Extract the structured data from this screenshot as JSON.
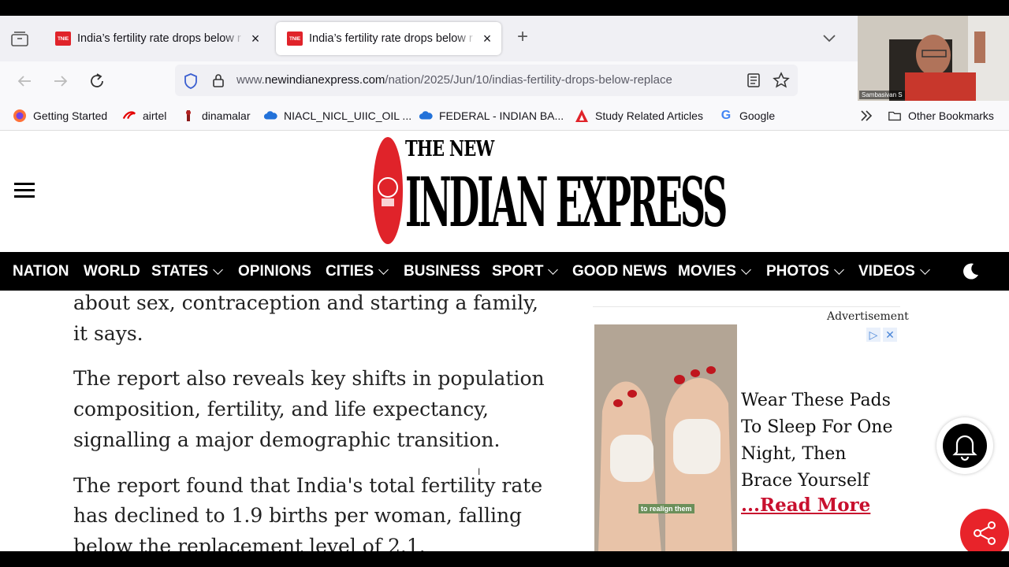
{
  "browser": {
    "tabs": [
      {
        "favicon_text": "TNIE",
        "title": "India’s fertility rate drops below r"
      },
      {
        "favicon_text": "TNIE",
        "title": "India’s fertility rate drops below r"
      }
    ],
    "url_prefix": "www.",
    "url_domain": "newindianexpress.com",
    "url_path": "/nation/2025/Jun/10/indias-fertility-drops-below-replace",
    "bookmarks": [
      "Getting Started",
      "airtel",
      "dinamalar",
      "NIACL_NICL_UIIC_OIL ...",
      "FEDERAL - INDIAN BA...",
      "Study Related Articles",
      "Google"
    ],
    "other_bookmarks": "Other Bookmarks",
    "video_name": "Sambasivan S"
  },
  "site": {
    "logo_top": "THE NEW",
    "logo_main": "INDIAN EXPRESS",
    "nav": [
      {
        "label": "NATION",
        "dropdown": false
      },
      {
        "label": "WORLD",
        "dropdown": false
      },
      {
        "label": "STATES",
        "dropdown": true
      },
      {
        "label": "OPINIONS",
        "dropdown": false
      },
      {
        "label": "CITIES",
        "dropdown": true
      },
      {
        "label": "BUSINESS",
        "dropdown": false
      },
      {
        "label": "SPORT",
        "dropdown": true
      },
      {
        "label": "GOOD NEWS",
        "dropdown": false
      },
      {
        "label": "MOVIES",
        "dropdown": true
      },
      {
        "label": "PHOTOS",
        "dropdown": true
      },
      {
        "label": "VIDEOS",
        "dropdown": true
      }
    ]
  },
  "article": {
    "paragraphs": [
      "about sex, contraception and starting a family, it says.",
      "The report also reveals key shifts in population composition, fertility, and life expectancy, signalling a major demographic transition.",
      "The report found that India's total fertility rate has declined to 1.9 births per woman, falling below the replacement level of 2.1."
    ]
  },
  "ad": {
    "label": "Advertisement",
    "caption": "to realign them",
    "headline": "Wear These Pads To Sleep For One Night, Then Brace Yourself",
    "link": "...Read More"
  }
}
